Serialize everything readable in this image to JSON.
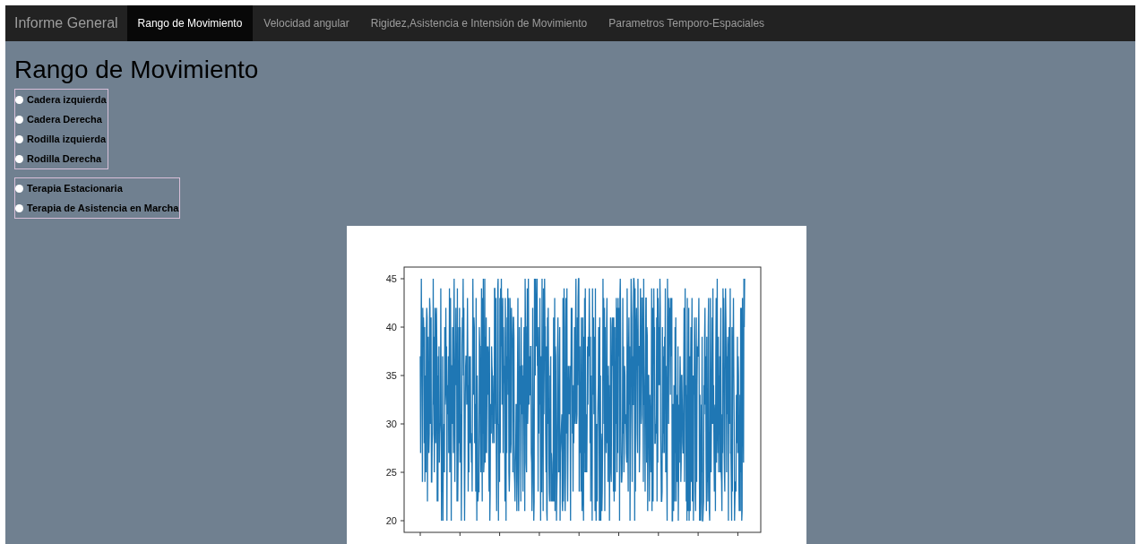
{
  "navbar": {
    "brand": "Informe General",
    "tabs": [
      {
        "label": "Rango de Movimiento",
        "selected": true
      },
      {
        "label": "Velocidad angular",
        "selected": false
      },
      {
        "label": "Rigidez,Asistencia e Intensión de Movimiento",
        "selected": false
      },
      {
        "label": "Parametros Temporo-Espaciales",
        "selected": false
      }
    ]
  },
  "page_title": "Rango de Movimiento",
  "joint_options": [
    {
      "label": "Cadera izquierda",
      "selected": false
    },
    {
      "label": "Cadera Derecha",
      "selected": false
    },
    {
      "label": "Rodilla izquierda",
      "selected": false
    },
    {
      "label": "Rodilla Derecha",
      "selected": false
    }
  ],
  "therapy_options": [
    {
      "label": "Terapia Estacionaria",
      "selected": false
    },
    {
      "label": "Terapia de Asistencia en Marcha",
      "selected": false
    }
  ],
  "plot": {
    "y_tick_labels": [
      "45",
      "40",
      "35",
      "30",
      "25",
      "20"
    ]
  }
}
